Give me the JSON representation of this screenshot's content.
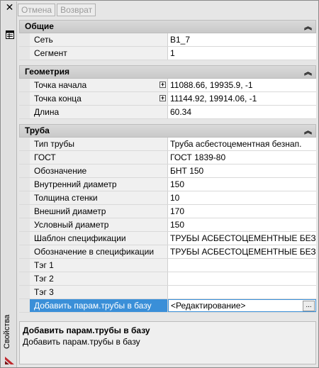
{
  "panel": {
    "vertical_title": "Свойства",
    "close_icon": "close-icon",
    "properties_icon": "properties-icon",
    "app_icon": "app-logo-icon"
  },
  "toolbar": {
    "cancel_label": "Отмена",
    "back_label": "Возврат"
  },
  "sections": {
    "general": {
      "title": "Общие",
      "rows": [
        {
          "name": "Сеть",
          "value": "В1_7"
        },
        {
          "name": "Сегмент",
          "value": "1"
        }
      ]
    },
    "geometry": {
      "title": "Геометрия",
      "rows": [
        {
          "name": "Точка начала",
          "value": "11088.66, 19935.9, -1"
        },
        {
          "name": "Точка конца",
          "value": "11144.92, 19914.06, -1"
        },
        {
          "name": "Длина",
          "value": "60.34"
        }
      ]
    },
    "pipe": {
      "title": "Труба",
      "rows": [
        {
          "name": "Тип трубы",
          "value": "Труба асбестоцементная безнап."
        },
        {
          "name": "ГОСТ",
          "value": "ГОСТ 1839-80"
        },
        {
          "name": "Обозначение",
          "value": "БНТ 150"
        },
        {
          "name": "Внутренний диаметр",
          "value": "150"
        },
        {
          "name": "Толщина стенки",
          "value": "10"
        },
        {
          "name": "Внешний диаметр",
          "value": "170"
        },
        {
          "name": "Условный диаметр",
          "value": "150"
        },
        {
          "name": "Шаблон спецификации",
          "value": "ТРУБЫ АСБЕСТОЦЕМЕНТНЫЕ БЕЗ..."
        },
        {
          "name": "Обозначение в спецификации",
          "value": "ТРУБЫ АСБЕСТОЦЕМЕНТНЫЕ БЕЗ..."
        },
        {
          "name": "Тэг 1",
          "value": ""
        },
        {
          "name": "Тэг 2",
          "value": ""
        },
        {
          "name": "Тэг 3",
          "value": ""
        },
        {
          "name": "Добавить парам.трубы в базу",
          "value": "<Редактирование>"
        }
      ],
      "ellipsis_label": "..."
    }
  },
  "description": {
    "title": "Добавить парам.трубы в базу",
    "text": "Добавить парам.трубы в базу"
  },
  "colors": {
    "selection": "#3a8fd8"
  }
}
